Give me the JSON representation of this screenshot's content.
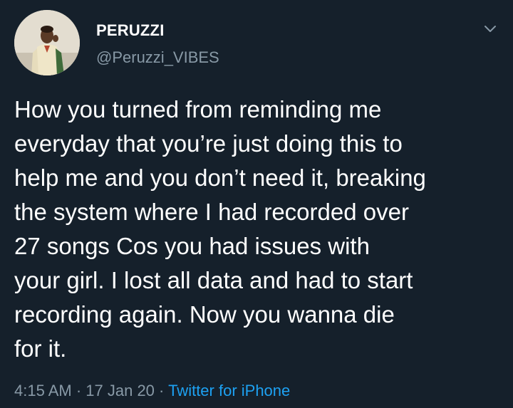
{
  "author": {
    "display_name": "PERUZZI",
    "handle": "@Peruzzi_VIBES",
    "avatar_icon": "profile-photo"
  },
  "tweet": {
    "text": "How you turned from reminding me\neveryday that you’re just doing this to\nhelp me and you don’t need it, breaking\nthe system where I had recorded over\n27 songs Cos you had issues with\nyour girl. I lost all data and had to start\nrecording again. Now you wanna die\nfor it."
  },
  "meta": {
    "time": "4:15 AM",
    "separator": " · ",
    "date": "17 Jan 20",
    "source": "Twitter for iPhone"
  },
  "menu": {
    "icon": "chevron-down-icon"
  },
  "colors": {
    "background": "#15202b",
    "text": "#ffffff",
    "secondary": "#8899a6",
    "accent": "#1da1f2"
  }
}
